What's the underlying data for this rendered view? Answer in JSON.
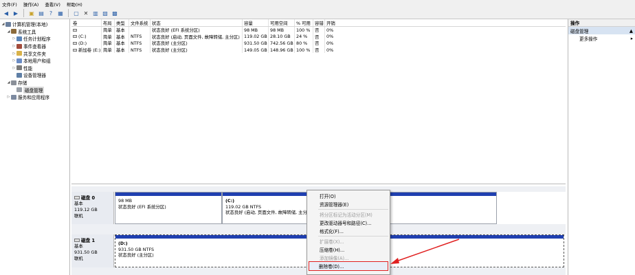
{
  "menubar": [
    "文件(F)",
    "操作(A)",
    "查看(V)",
    "帮助(H)"
  ],
  "tree": [
    {
      "label": "计算机管理(本地)",
      "indent": 0,
      "exp": "◢",
      "icon": "#6a7f9e",
      "name": "tree-computer-management"
    },
    {
      "label": "系统工具",
      "indent": 1,
      "exp": "◢",
      "icon": "#8b6a3a",
      "name": "tree-system-tools"
    },
    {
      "label": "任务计划程序",
      "indent": 2,
      "exp": "▷",
      "icon": "#5a84b8",
      "name": "tree-task-scheduler"
    },
    {
      "label": "事件查看器",
      "indent": 2,
      "exp": "▷",
      "icon": "#a34b3b",
      "name": "tree-event-viewer"
    },
    {
      "label": "共享文件夹",
      "indent": 2,
      "exp": "▷",
      "icon": "#d9b24a",
      "name": "tree-shared-folders"
    },
    {
      "label": "本地用户和组",
      "indent": 2,
      "exp": "▷",
      "icon": "#6a8cc5",
      "name": "tree-local-users"
    },
    {
      "label": "性能",
      "indent": 2,
      "exp": "▷",
      "icon": "#7a7a7a",
      "name": "tree-performance"
    },
    {
      "label": "设备管理器",
      "indent": 2,
      "exp": "",
      "icon": "#5e7fa6",
      "name": "tree-device-manager"
    },
    {
      "label": "存储",
      "indent": 1,
      "exp": "◢",
      "icon": "#8a8f98",
      "name": "tree-storage"
    },
    {
      "label": "磁盘管理",
      "indent": 2,
      "exp": "",
      "icon": "#9aa0a8",
      "name": "tree-disk-management",
      "selected": true
    },
    {
      "label": "服务和应用程序",
      "indent": 1,
      "exp": "▷",
      "icon": "#7d8aa0",
      "name": "tree-services-apps"
    }
  ],
  "volume_table": {
    "headers": [
      "卷",
      "布局",
      "类型",
      "文件系统",
      "状态",
      "容量",
      "可用空间",
      "% 可用",
      "容错",
      "开销"
    ],
    "rows": [
      [
        "",
        "简单",
        "基本",
        "",
        "状态良好 (EFI 系统分区)",
        "98 MB",
        "98 MB",
        "100 %",
        "否",
        "0%"
      ],
      [
        "(C:)",
        "简单",
        "基本",
        "NTFS",
        "状态良好 (启动, 页面文件, 故障转储, 主分区)",
        "119.02 GB",
        "28.10 GB",
        "24 %",
        "否",
        "0%"
      ],
      [
        "(D:)",
        "简单",
        "基本",
        "NTFS",
        "状态良好 (主分区)",
        "931.50 GB",
        "742.56 GB",
        "80 %",
        "否",
        "0%"
      ],
      [
        "新加卷 (E:)",
        "简单",
        "基本",
        "NTFS",
        "状态良好 (主分区)",
        "149.05 GB",
        "148.96 GB",
        "100 %",
        "否",
        "0%"
      ]
    ]
  },
  "disks": [
    {
      "title": "磁盘 0",
      "type": "基本",
      "size": "119.12 GB",
      "status": "联机",
      "partitions": [
        {
          "name": "",
          "size": "98 MB",
          "status": "状态良好 (EFI 系统分区)"
        },
        {
          "name": "(C:)",
          "size": "119.02 GB NTFS",
          "status": "状态良好 (启动, 页面文件, 故障转储, 主分区)"
        }
      ]
    },
    {
      "title": "磁盘 1",
      "type": "基本",
      "size": "931.50 GB",
      "status": "联机",
      "partitions": [
        {
          "name": "(D:)",
          "size": "931.50 GB NTFS",
          "status": "状态良好 (主分区)"
        }
      ]
    }
  ],
  "actions": {
    "header": "操作",
    "section": "磁盘管理",
    "more": "更多操作"
  },
  "context_menu": [
    {
      "label": "打开(O)",
      "enabled": true
    },
    {
      "label": "资源管理器(E)",
      "enabled": true
    },
    {
      "sep": true
    },
    {
      "label": "将分区标记为活动分区(M)",
      "enabled": false
    },
    {
      "label": "更改驱动器号和路径(C)...",
      "enabled": true
    },
    {
      "label": "格式化(F)...",
      "enabled": true
    },
    {
      "sep": true
    },
    {
      "label": "扩展卷(X)...",
      "enabled": false
    },
    {
      "label": "压缩卷(H)...",
      "enabled": true
    },
    {
      "label": "添加镜像(A)...",
      "enabled": false
    },
    {
      "label": "删除卷(D)...",
      "enabled": true,
      "highlight": true
    }
  ],
  "colors": {
    "partition_bar": "#1f3fb0",
    "annotation": "#e02020",
    "selection": "#d7e3f2"
  }
}
